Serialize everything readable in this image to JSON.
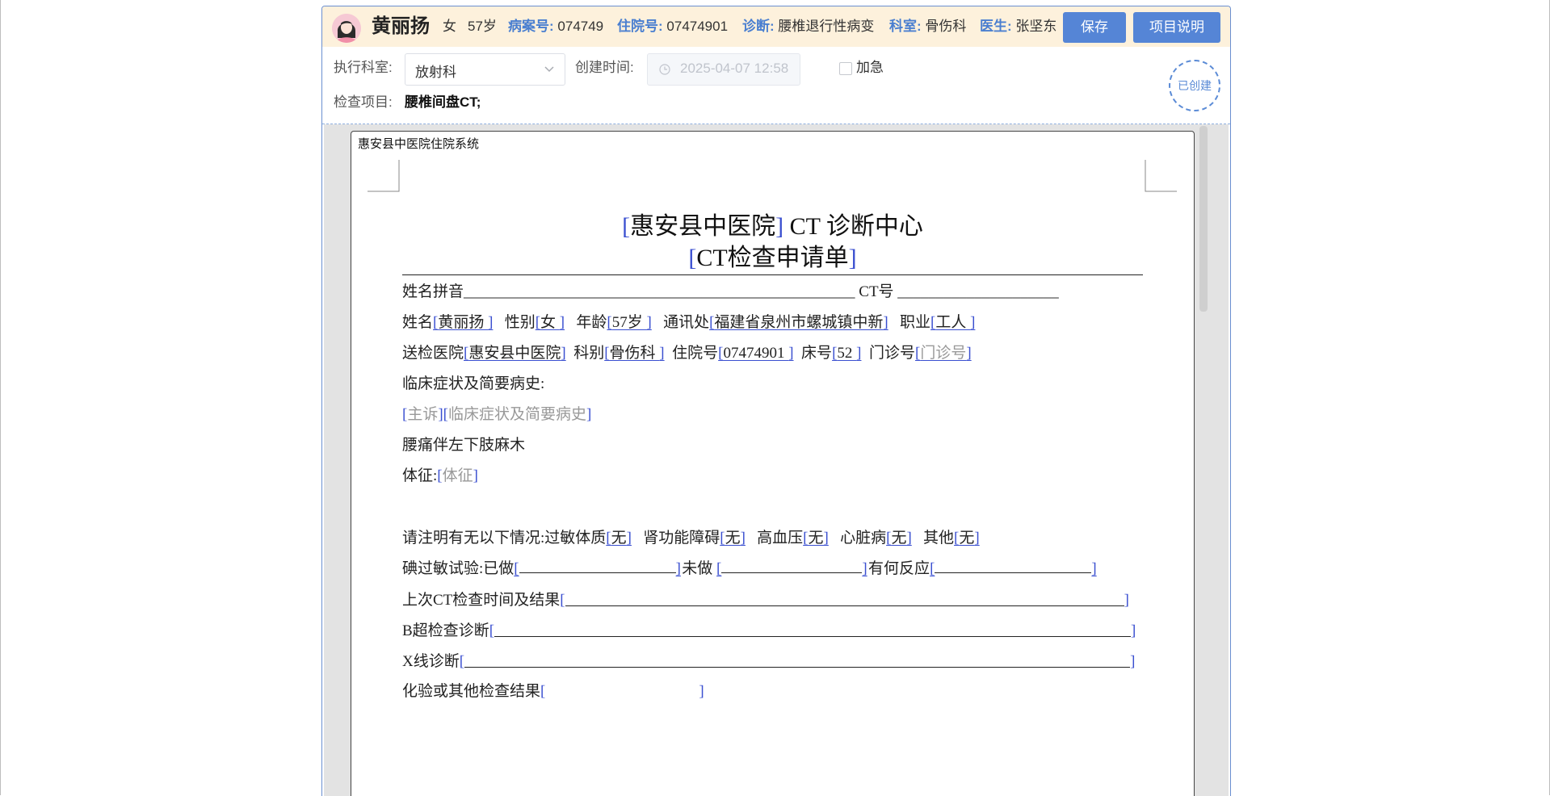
{
  "patient": {
    "name": "黄丽扬",
    "gender": "女",
    "age": "57岁",
    "case_no_label": "病案号:",
    "case_no": "074749",
    "inpatient_no_label": "住院号:",
    "inpatient_no": "07474901",
    "diagnosis_label": "诊断:",
    "diagnosis": "腰椎退行性病变",
    "dept_label": "科室:",
    "dept": "骨伤科",
    "doctor_label": "医生:",
    "doctor": "张坚东"
  },
  "buttons": {
    "save": "保存",
    "project_info": "项目说明"
  },
  "form": {
    "exec_dept_label": "执行科室:",
    "exec_dept_value": "放射科",
    "create_time_label": "创建时间:",
    "create_time_value": "2025-04-07 12:58",
    "urgent_label": "加急",
    "exam_item_label": "检查项目:",
    "exam_item_value": "腰椎间盘CT;",
    "status_stamp": "已创建"
  },
  "document": {
    "system_name": "惠安县中医院住院系统",
    "title_hospital": "惠安县中医院",
    "title_rest": " CT 诊断中心",
    "subtitle": "CT检查申请单",
    "row1": {
      "pinyin_label": "姓名拼音",
      "pinyin_blank": "___________________________________________________",
      "ct_label": " CT号 ",
      "ct_blank": "_____________________"
    },
    "row2": {
      "name_label": "姓名",
      "name_value": "黄丽扬  ",
      "gender_label": "性别",
      "gender_value": "女  ",
      "age_label": "年龄",
      "age_value": "57岁  ",
      "address_label": "通讯处",
      "address_value": "福建省泉州市螺城镇中新",
      "job_label": "职业",
      "job_value": "工人      "
    },
    "row3": {
      "hospital_label": "送检医院",
      "hospital_value": "惠安县中医院",
      "dept_label": "科别",
      "dept_value": "骨伤科  ",
      "inpatient_label": "住院号",
      "inpatient_value": "07474901    ",
      "bed_label": "床号",
      "bed_value": "52    ",
      "outpatient_label": "门诊号",
      "outpatient_placeholder": "门诊号"
    },
    "clinical_label": "临床症状及简要病史:",
    "chief_complaint_placeholder": "主诉",
    "clinical_placeholder": "临床症状及简要病史",
    "clinical_text": "腰痛伴左下肢麻木",
    "signs_label": "体征:",
    "signs_placeholder": "体征",
    "conditions": {
      "label": "请注明有无以下情况:",
      "allergy_label": "过敏体质",
      "allergy_value": "无",
      "kidney_label": "肾功能障碍",
      "kidney_value": "无",
      "hypertension_label": "高血压",
      "hypertension_value": "无",
      "heart_label": "心脏病",
      "heart_value": "无",
      "other_label": "其他",
      "other_value": "无"
    },
    "iodine": {
      "label": "碘过敏试验:已做",
      "not_done_label": "未做 ",
      "reaction_label": "有何反应"
    },
    "last_ct_label": "上次CT检查时间及结果",
    "b_ultrasound_label": "B超检查诊断",
    "xray_label": "X线诊断",
    "lab_label": "化验或其他检查结果"
  },
  "icons": [
    "avatar",
    "chevron-down-icon",
    "clock-icon"
  ]
}
